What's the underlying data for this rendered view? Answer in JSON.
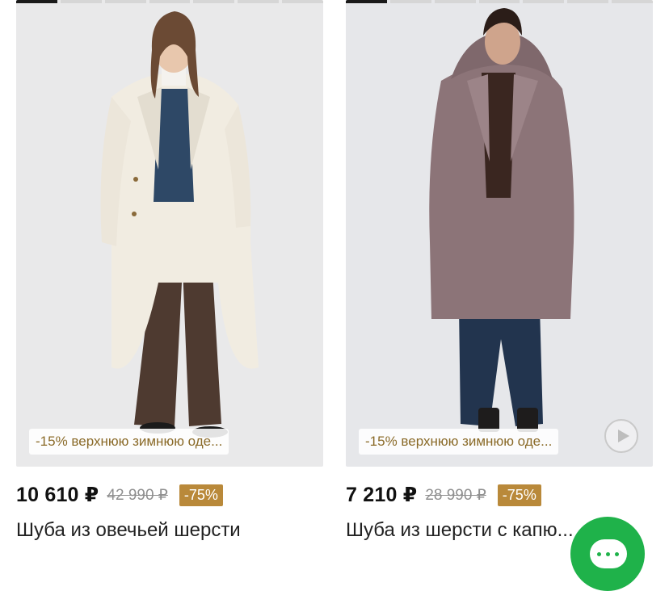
{
  "products": [
    {
      "promo": "-15% верхнюю зимнюю оде...",
      "price": "10 610 ₽",
      "old_price": "42 990 ₽",
      "discount": "-75%",
      "title": "Шуба из овечьей шерсти",
      "slides": 7,
      "active_slide": 1
    },
    {
      "promo": "-15% верхнюю зимнюю оде...",
      "price": "7 210 ₽",
      "old_price": "28 990 ₽",
      "discount": "-75%",
      "title": "Шуба из шерсти с капю...",
      "slides": 7,
      "active_slide": 1
    }
  ],
  "icons": {
    "play": "play-icon",
    "chat": "chat-icon"
  },
  "colors": {
    "promo_text": "#8a6a28",
    "discount_bg": "#b9893a",
    "chat_bg": "#1fb24a"
  }
}
